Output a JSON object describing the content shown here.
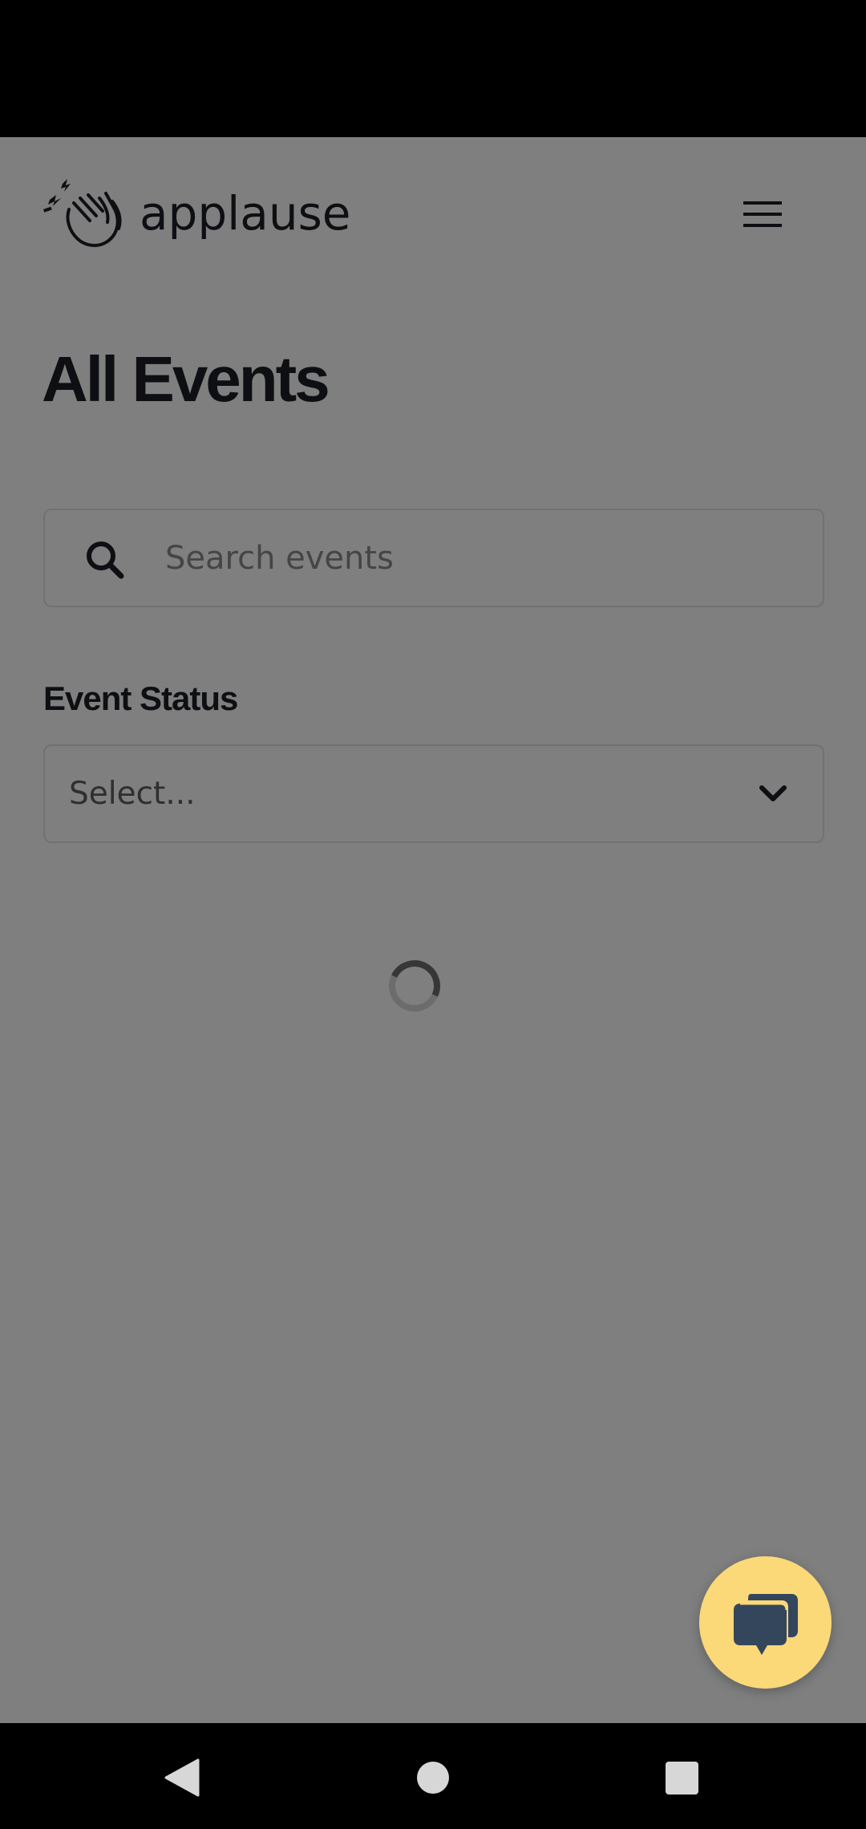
{
  "app": {
    "logo_text": "applause"
  },
  "header": {
    "menu_icon": "hamburger-menu-icon"
  },
  "page": {
    "title": "All Events"
  },
  "search": {
    "icon": "search-icon",
    "placeholder": "Search events",
    "value": ""
  },
  "filter": {
    "label": "Event Status",
    "selected": "Select...",
    "icon": "chevron-down-icon"
  },
  "loading": {
    "icon": "loading-spinner-icon"
  },
  "chat": {
    "icon": "chat-bubbles-icon",
    "accent": "#fbd878",
    "icon_color": "#34465c"
  },
  "nav": {
    "back_icon": "back-triangle-icon",
    "home_icon": "home-circle-icon",
    "recents_icon": "recents-square-icon"
  },
  "colors": {
    "text_dark": "#1d1f27",
    "overlay": "rgba(0,0,0,0.5)",
    "border": "#e2e2e2"
  }
}
